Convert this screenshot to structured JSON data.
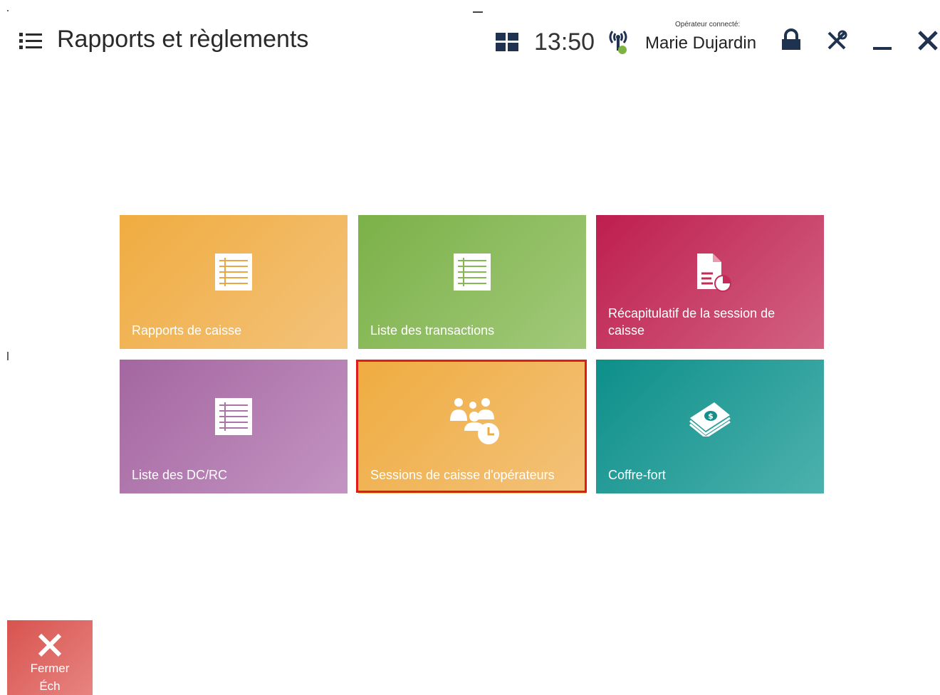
{
  "header": {
    "title": "Rapports et règlements",
    "time": "13:50",
    "operator_label": "Opérateur connecté:",
    "operator_name": "Marie Dujardin"
  },
  "tiles": [
    {
      "label": "Rapports de caisse",
      "icon": "list-icon",
      "color": "#f0ac40"
    },
    {
      "label": "Liste des transactions",
      "icon": "list-icon",
      "color": "#7bb148"
    },
    {
      "label": "Récapitulatif de la session de caisse",
      "icon": "document-chart-icon",
      "color": "#be1e4e"
    },
    {
      "label": "Liste des DC/RC",
      "icon": "list-icon",
      "color": "#a466a0"
    },
    {
      "label": "Sessions de caisse d'opérateurs",
      "icon": "operators-clock-icon",
      "color": "#efac40",
      "selected": true
    },
    {
      "label": "Coffre-fort",
      "icon": "money-stack-icon",
      "color": "#0d8f8a"
    }
  ],
  "footer": {
    "close_line1": "Fermer",
    "close_line2": "Éch"
  }
}
